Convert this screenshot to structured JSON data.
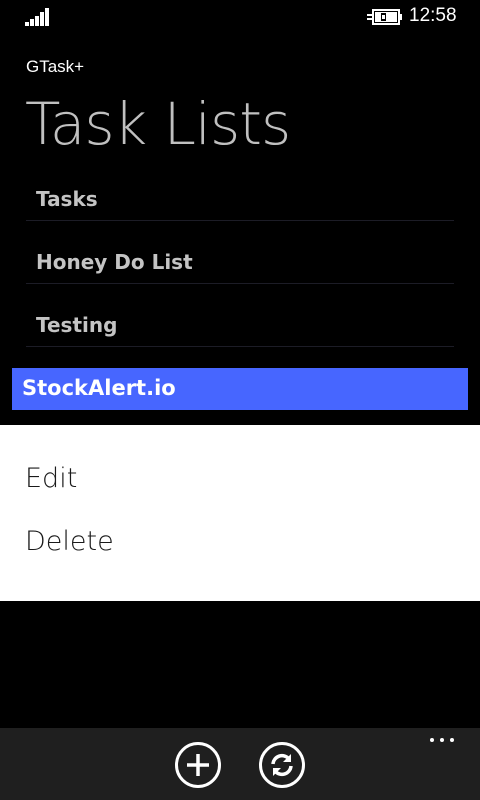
{
  "status_bar": {
    "time": "12:58",
    "signal_icon": "signal-strength-icon",
    "battery_icon": "battery-charging-icon"
  },
  "header": {
    "app_name": "GTask+",
    "title": "Task Lists"
  },
  "task_lists": [
    {
      "label": "Tasks"
    },
    {
      "label": "Honey Do List"
    },
    {
      "label": "Testing"
    }
  ],
  "selected_list": {
    "label": "StockAlert.io",
    "highlight_color": "#4766ff"
  },
  "context_menu": {
    "edit_label": "Edit",
    "delete_label": "Delete"
  },
  "app_bar": {
    "add_icon": "add-icon",
    "sync_icon": "sync-icon",
    "more_icon": "more-icon"
  }
}
